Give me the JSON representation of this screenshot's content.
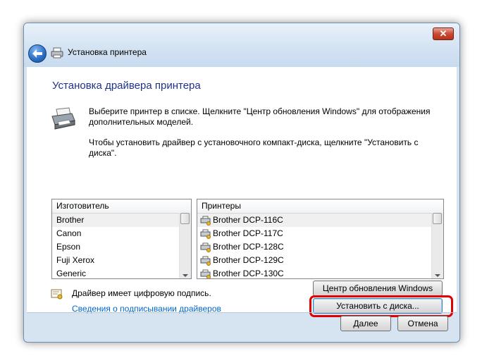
{
  "window": {
    "close_label": "✕",
    "title": "Установка принтера"
  },
  "page": {
    "heading": "Установка драйвера принтера",
    "instruction1": "Выберите принтер в списке. Щелкните \"Центр обновления Windows\" для отображения дополнительных моделей.",
    "instruction2": "Чтобы установить драйвер с установочного компакт-диска, щелкните \"Установить с диска\"."
  },
  "manufacturer_list": {
    "header": "Изготовитель",
    "items": [
      "Brother",
      "Canon",
      "Epson",
      "Fuji Xerox",
      "Generic"
    ],
    "selected": "Brother"
  },
  "printer_list": {
    "header": "Принтеры",
    "items": [
      "Brother DCP-116C",
      "Brother DCP-117C",
      "Brother DCP-128C",
      "Brother DCP-129C",
      "Brother DCP-130C"
    ],
    "selected": "Brother DCP-116C"
  },
  "signature": {
    "text": "Драйвер имеет цифровую подпись.",
    "link": "Сведения о подписывании драйверов"
  },
  "buttons": {
    "windows_update": "Центр обновления Windows",
    "have_disk": "Установить с диска...",
    "next": "Далее",
    "cancel": "Отмена"
  },
  "colors": {
    "heading": "#1e3287",
    "link": "#0066cc",
    "highlight": "#e00000"
  }
}
